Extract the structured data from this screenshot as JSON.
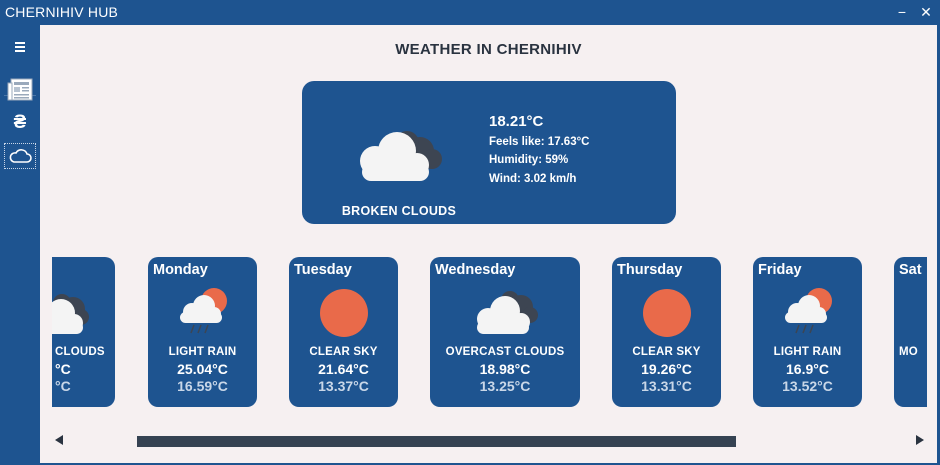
{
  "app": {
    "title": "CHERNIHIV HUB"
  },
  "window_controls": {
    "minimize": "−",
    "close": "✕"
  },
  "sidebar": {
    "items": [
      {
        "name": "menu",
        "icon": "hamburger-menu-icon"
      },
      {
        "name": "news",
        "icon": "newspaper-icon"
      },
      {
        "name": "currency",
        "icon": "hryvnia-icon",
        "glyph": "₴"
      },
      {
        "name": "weather",
        "icon": "cloud-icon",
        "active": true
      }
    ]
  },
  "page": {
    "heading": "WEATHER IN CHERNIHIV"
  },
  "current": {
    "temp": "18.21°C",
    "feels_like": "Feels like: 17.63°C",
    "humidity": "Humidity: 59%",
    "wind": "Wind: 3.02 km/h",
    "description": "BROKEN CLOUDS",
    "icon": "broken-clouds-icon"
  },
  "forecast": [
    {
      "day": "",
      "description": "CLOUDS",
      "high": "°C",
      "low": "°C",
      "icon": "dark-clouds-icon"
    },
    {
      "day": "Monday",
      "description": "LIGHT RAIN",
      "high": "25.04°C",
      "low": "16.59°C",
      "icon": "light-rain-icon"
    },
    {
      "day": "Tuesday",
      "description": "CLEAR SKY",
      "high": "21.64°C",
      "low": "13.37°C",
      "icon": "sun-icon"
    },
    {
      "day": "Wednesday",
      "description": "OVERCAST CLOUDS",
      "high": "18.98°C",
      "low": "13.25°C",
      "icon": "overcast-clouds-icon"
    },
    {
      "day": "Thursday",
      "description": "CLEAR SKY",
      "high": "19.26°C",
      "low": "13.31°C",
      "icon": "sun-icon"
    },
    {
      "day": "Friday",
      "description": "LIGHT RAIN",
      "high": "16.9°C",
      "low": "13.52°C",
      "icon": "light-rain-icon"
    },
    {
      "day": "Sat",
      "description": "MO",
      "high": "",
      "low": "",
      "icon": ""
    }
  ],
  "colors": {
    "accent": "#1e5490",
    "background": "#f6f0f1",
    "sun": "#e96a4a",
    "cloud": "#f4f4f4",
    "dark_cloud": "#3d4552"
  }
}
